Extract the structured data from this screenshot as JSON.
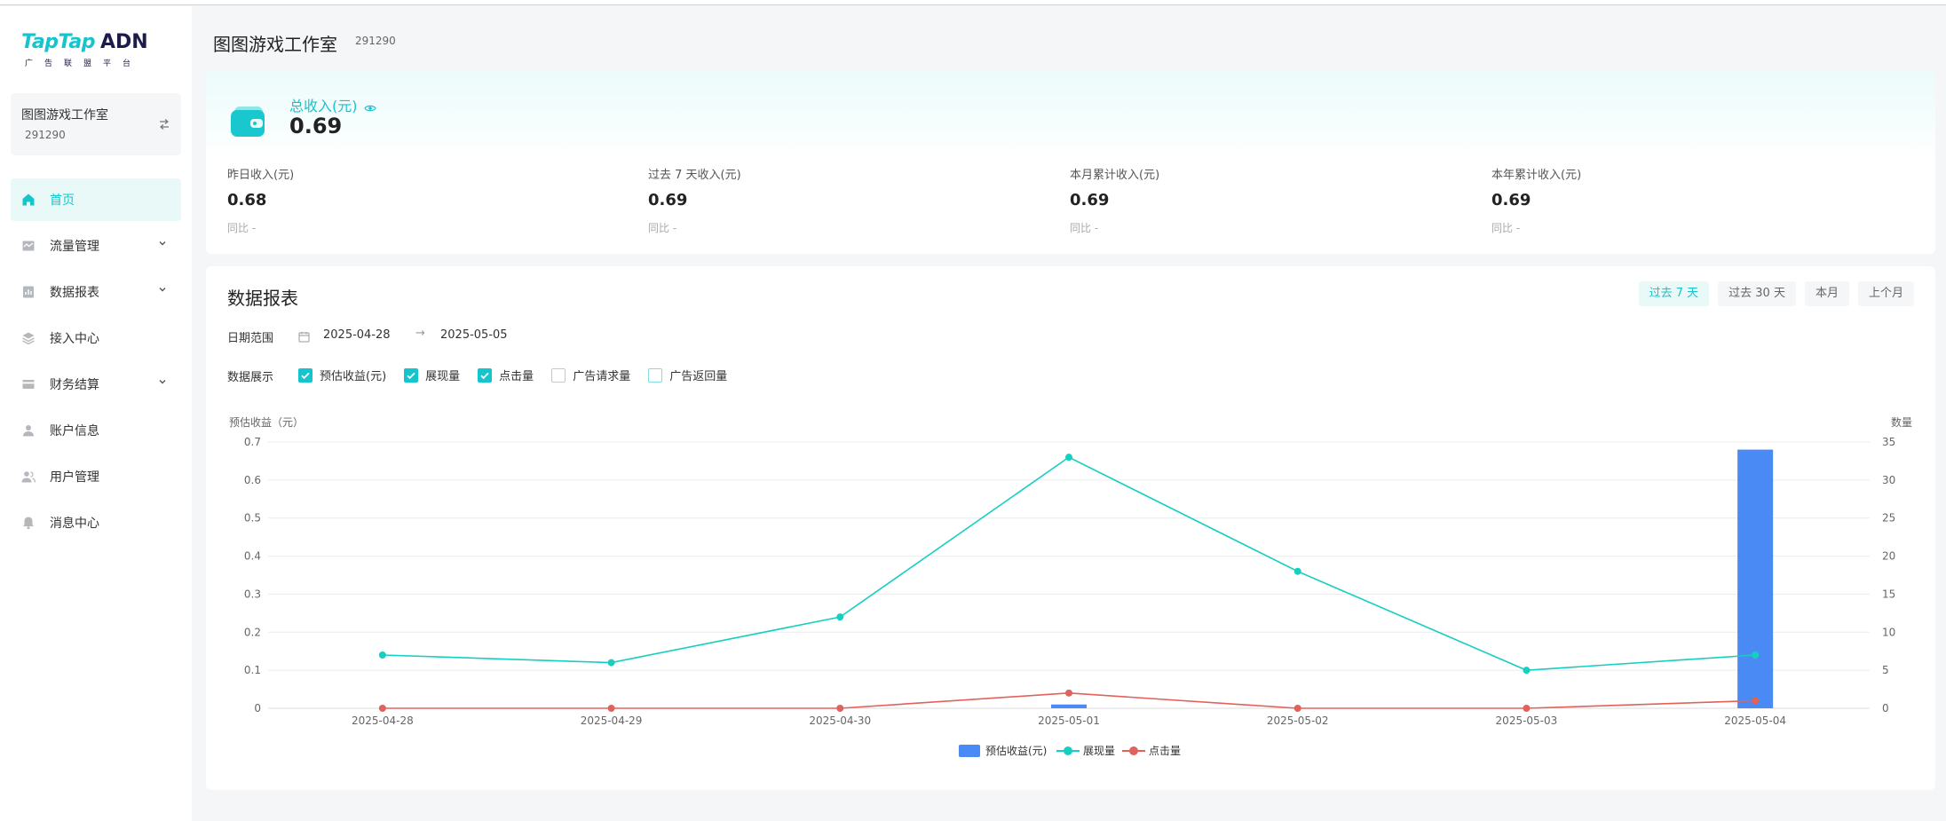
{
  "brand": {
    "logo_text": "TapTap",
    "logo_suffix": "ADN",
    "logo_sub": "广告联盟平台"
  },
  "account": {
    "name": "图图游戏工作室",
    "id": "291290"
  },
  "nav": [
    {
      "label": "首页",
      "icon": "home-icon",
      "active": true,
      "expandable": false
    },
    {
      "label": "流量管理",
      "icon": "traffic-icon",
      "active": false,
      "expandable": true
    },
    {
      "label": "数据报表",
      "icon": "report-icon",
      "active": false,
      "expandable": true
    },
    {
      "label": "接入中心",
      "icon": "layers-icon",
      "active": false,
      "expandable": false
    },
    {
      "label": "财务结算",
      "icon": "card-icon",
      "active": false,
      "expandable": true
    },
    {
      "label": "账户信息",
      "icon": "user-icon",
      "active": false,
      "expandable": false
    },
    {
      "label": "用户管理",
      "icon": "users-icon",
      "active": false,
      "expandable": false
    },
    {
      "label": "消息中心",
      "icon": "bell-icon",
      "active": false,
      "expandable": false
    }
  ],
  "header": {
    "title": "图图游戏工作室",
    "id": "291290"
  },
  "revenue": {
    "total_label": "总收入(元)",
    "total_value": "0.69",
    "stats": [
      {
        "label": "昨日收入(元)",
        "value": "0.68",
        "yoy": "同比 -"
      },
      {
        "label": "过去 7 天收入(元)",
        "value": "0.69",
        "yoy": "同比 -"
      },
      {
        "label": "本月累计收入(元)",
        "value": "0.69",
        "yoy": "同比 -"
      },
      {
        "label": "本年累计收入(元)",
        "value": "0.69",
        "yoy": "同比 -"
      }
    ]
  },
  "report": {
    "title": "数据报表",
    "ranges": [
      {
        "label": "过去 7 天",
        "active": true
      },
      {
        "label": "过去 30 天",
        "active": false
      },
      {
        "label": "本月",
        "active": false
      },
      {
        "label": "上个月",
        "active": false
      }
    ],
    "date_label": "日期范围",
    "date_start": "2025-04-28",
    "date_end": "2025-05-05",
    "date_arrow": "→",
    "display_label": "数据展示",
    "metrics": [
      {
        "label": "预估收益(元)",
        "checked": true
      },
      {
        "label": "展现量",
        "checked": true
      },
      {
        "label": "点击量",
        "checked": true
      },
      {
        "label": "广告请求量",
        "checked": false
      },
      {
        "label": "广告返回量",
        "checked": false
      }
    ]
  },
  "colors": {
    "accent": "#15c5ce",
    "bar": "#4a8af4",
    "impressions": "#15cfc0",
    "clicks": "#e0625a"
  },
  "chart_data": {
    "type": "bar+line",
    "categories": [
      "2025-04-28",
      "2025-04-29",
      "2025-04-30",
      "2025-05-01",
      "2025-05-02",
      "2025-05-03",
      "2025-05-04"
    ],
    "ylabel_left": "预估收益（元）",
    "ylabel_right": "数量",
    "ylim_left": [
      0,
      0.7
    ],
    "ylim_right": [
      0,
      35
    ],
    "yticks_left": [
      "0",
      "0.1",
      "0.2",
      "0.3",
      "0.4",
      "0.5",
      "0.6",
      "0.7"
    ],
    "yticks_right": [
      "0",
      "5",
      "10",
      "15",
      "20",
      "25",
      "30",
      "35"
    ],
    "grid": true,
    "legend_position": "bottom",
    "series": [
      {
        "name": "预估收益(元)",
        "type": "bar",
        "axis": "left",
        "values": [
          0,
          0,
          0,
          0.01,
          0,
          0,
          0.68
        ]
      },
      {
        "name": "展现量",
        "type": "line",
        "axis": "right",
        "values": [
          7,
          6,
          12,
          33,
          18,
          5,
          7
        ]
      },
      {
        "name": "点击量",
        "type": "line",
        "axis": "right",
        "values": [
          0,
          0,
          0,
          2,
          0,
          0,
          1
        ]
      }
    ]
  }
}
